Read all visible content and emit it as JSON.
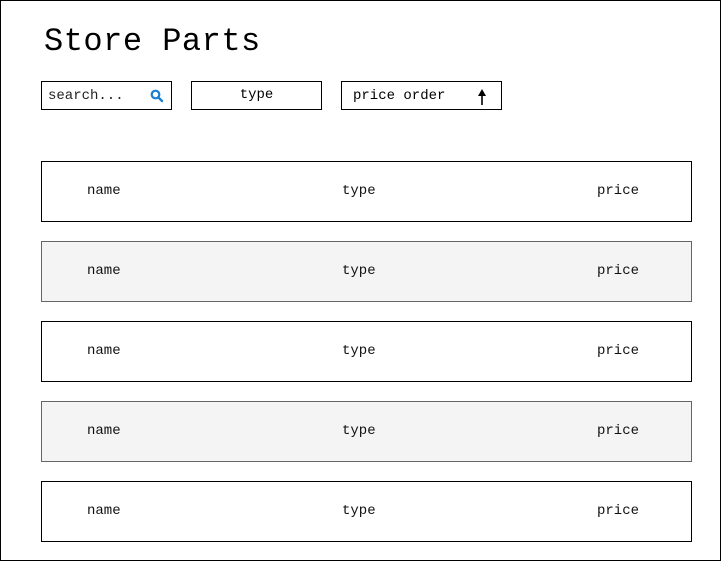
{
  "page": {
    "title": "Store Parts"
  },
  "toolbar": {
    "search_placeholder": "search...",
    "type_filter_label": "type",
    "price_order_label": "price order",
    "price_order_direction": "ascending",
    "search_icon": "search-icon",
    "sort_icon": "arrow-up-icon",
    "accent_color": "#1a7fd4"
  },
  "parts_table": {
    "rows": [
      {
        "name": "name",
        "type": "type",
        "price": "price"
      },
      {
        "name": "name",
        "type": "type",
        "price": "price"
      },
      {
        "name": "name",
        "type": "type",
        "price": "price"
      },
      {
        "name": "name",
        "type": "type",
        "price": "price"
      },
      {
        "name": "name",
        "type": "type",
        "price": "price"
      }
    ],
    "alt_row_color": "#f4f4f4"
  }
}
